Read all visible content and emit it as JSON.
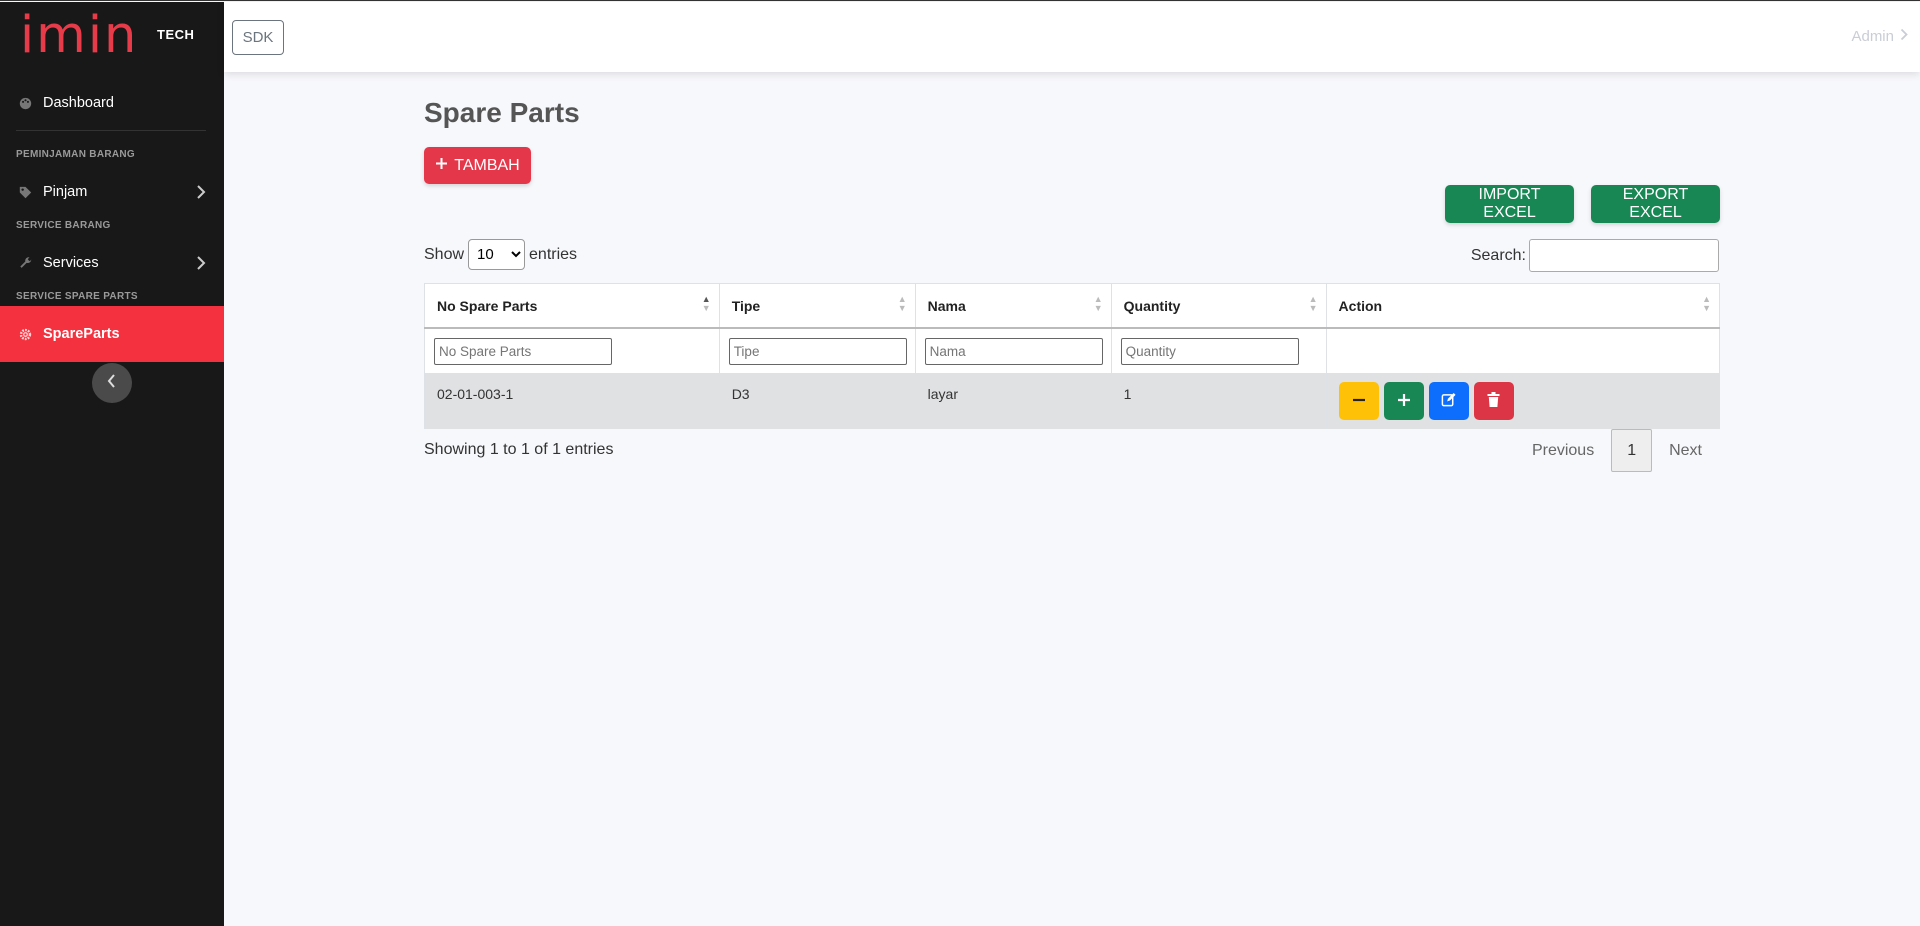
{
  "sidebar": {
    "logo": "imin",
    "logo_sub": "TECH",
    "dashboard": "Dashboard",
    "heading_peminjaman": "PEMINJAMAN BARANG",
    "pinjam": "Pinjam",
    "heading_service": "SERVICE BARANG",
    "services": "Services",
    "heading_spare": "SERVICE SPARE PARTS",
    "spareparts": "SpareParts"
  },
  "topbar": {
    "sdk": "SDK",
    "admin": "Admin"
  },
  "page": {
    "title": "Spare Parts",
    "tambah": "TAMBAH",
    "import": "IMPORT EXCEL",
    "export": "EXPORT EXCEL",
    "show": "Show",
    "entries_value": "10",
    "entries": "entries",
    "search": "Search:"
  },
  "table": {
    "headers": [
      "No Spare Parts",
      "Tipe",
      "Nama",
      "Quantity",
      "Action"
    ],
    "filters": [
      "No Spare Parts",
      "Tipe",
      "Nama",
      "Quantity"
    ],
    "rows": [
      {
        "no": "02-01-003-1",
        "tipe": "D3",
        "nama": "layar",
        "quantity": "1"
      }
    ]
  },
  "footer": {
    "info": "Showing 1 to 1 of 1 entries",
    "previous": "Previous",
    "page": "1",
    "next": "Next"
  },
  "colors": {
    "accent": "#f4323f",
    "logo": "#e83b4a",
    "green": "#198754",
    "sidebar": "#181818"
  }
}
